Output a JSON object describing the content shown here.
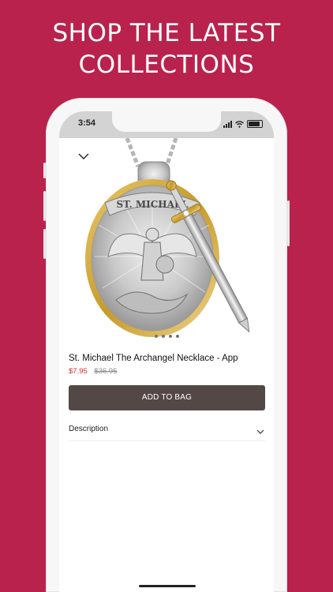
{
  "headline": {
    "line1": "SHOP THE LATEST",
    "line2": "COLLECTIONS"
  },
  "status_bar": {
    "time": "3:54"
  },
  "product": {
    "image_icon": "st-michael-medallion-image",
    "carousel_pages": 4,
    "title": "St. Michael The Archangel Necklace - App",
    "price": "$7.95",
    "original_price": "$36.95"
  },
  "actions": {
    "add_to_bag_label": "ADD TO BAG"
  },
  "description": {
    "label": "Description"
  },
  "colors": {
    "background": "#b8224d",
    "button": "#534846",
    "sale_price": "#cf2f2f"
  }
}
